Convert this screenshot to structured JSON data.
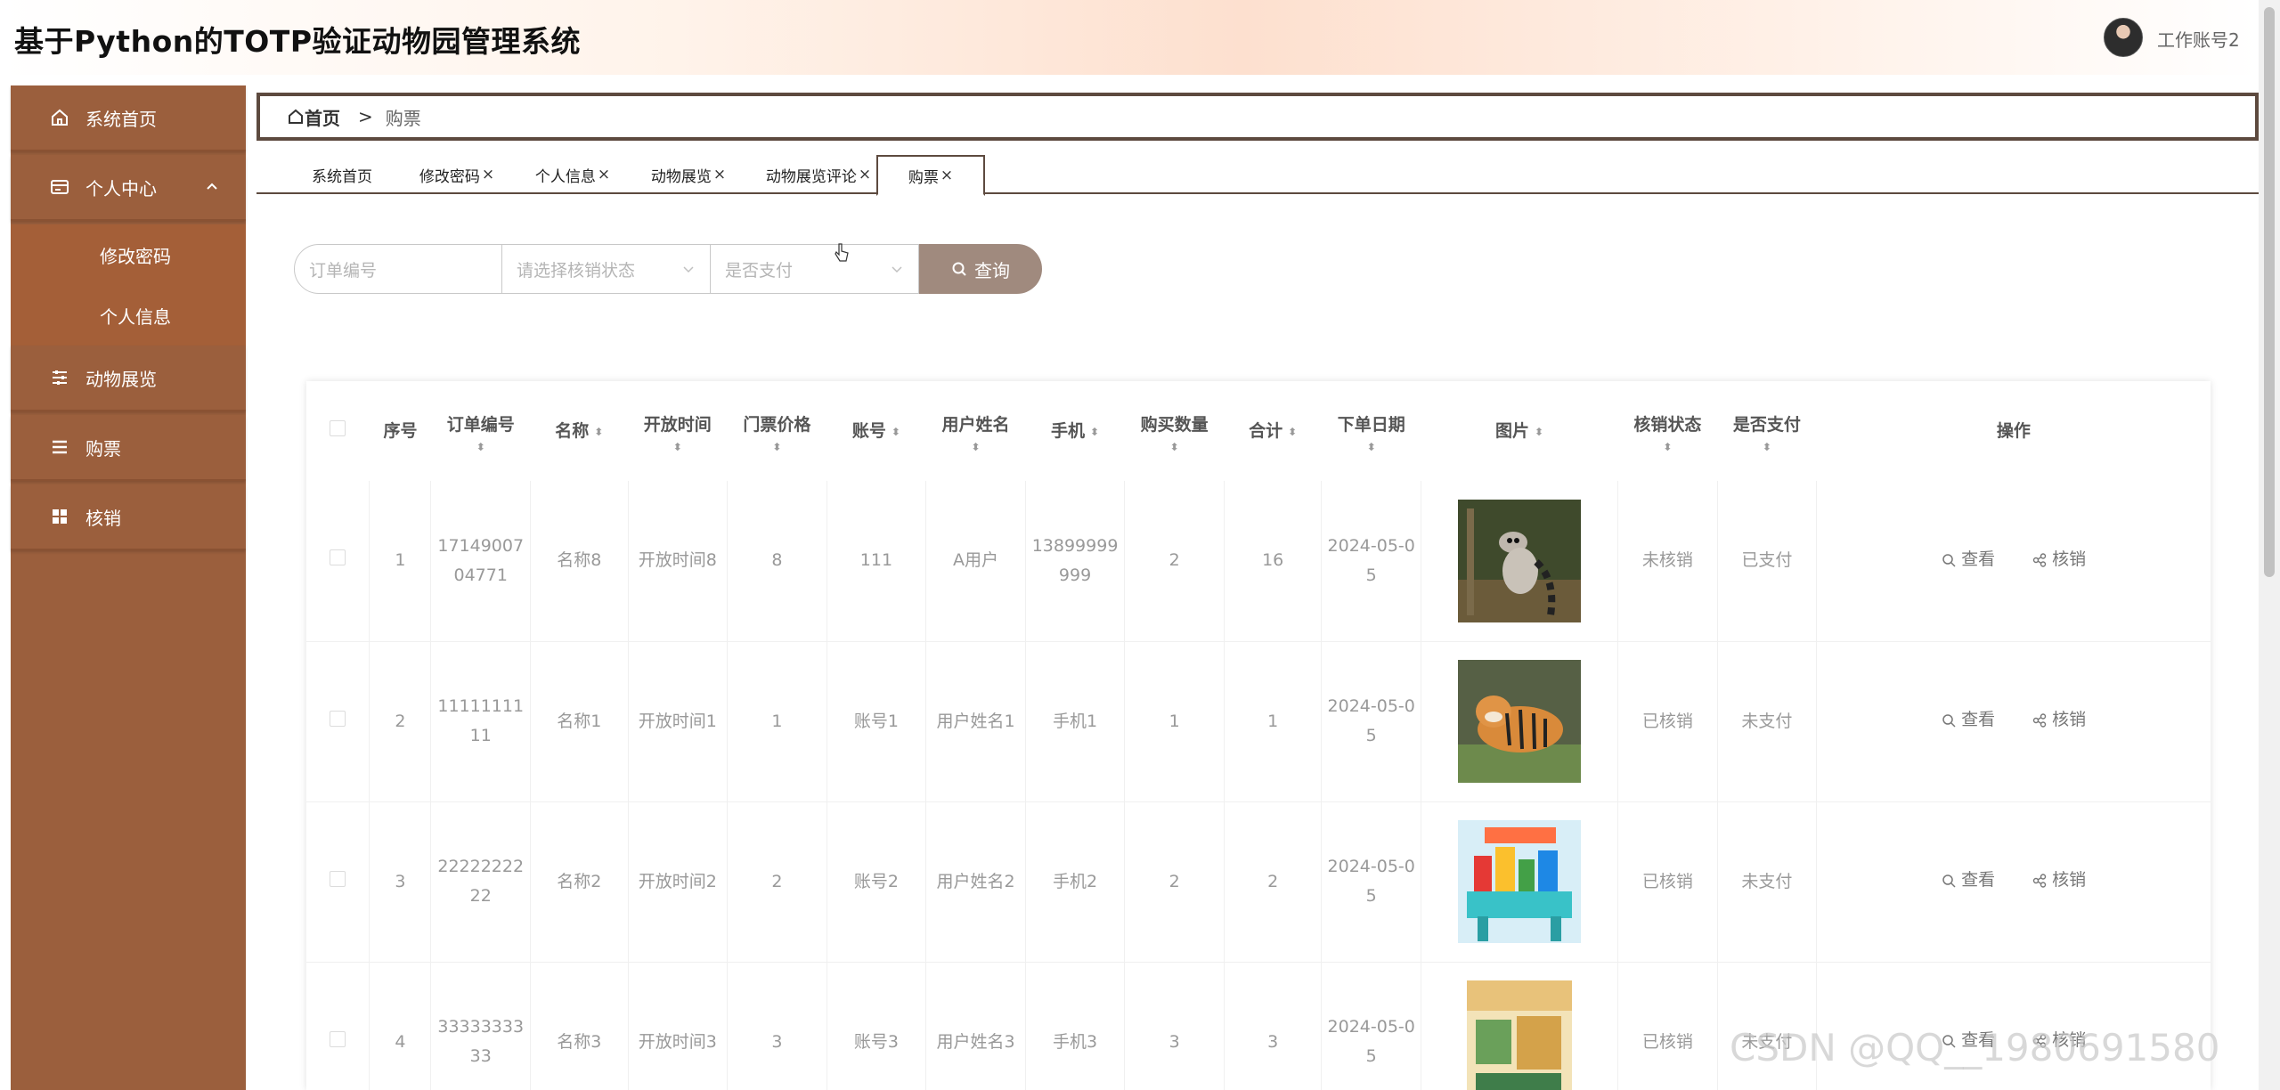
{
  "header": {
    "title": "基于Python的TOTP验证动物园管理系统",
    "user": "工作账号2"
  },
  "sidebar": {
    "items": [
      {
        "label": "系统首页",
        "icon": "home-icon"
      },
      {
        "label": "个人中心",
        "icon": "profile-card-icon"
      },
      {
        "label": "动物展览",
        "icon": "sliders-icon"
      },
      {
        "label": "购票",
        "icon": "list-icon"
      },
      {
        "label": "核销",
        "icon": "grid-icon"
      }
    ],
    "submenu": [
      {
        "label": "修改密码"
      },
      {
        "label": "个人信息"
      }
    ]
  },
  "breadcrumb": {
    "home": "首页",
    "separator": ">",
    "current": "购票"
  },
  "tabs": [
    {
      "label": "系统首页",
      "closable": false
    },
    {
      "label": "修改密码",
      "closable": true
    },
    {
      "label": "个人信息",
      "closable": true
    },
    {
      "label": "动物展览",
      "closable": true
    },
    {
      "label": "动物展览评论",
      "closable": true
    },
    {
      "label": "购票",
      "closable": true,
      "active": true
    }
  ],
  "search": {
    "order_placeholder": "订单编号",
    "status_placeholder": "请选择核销状态",
    "paid_placeholder": "是否支付",
    "button": "查询"
  },
  "table": {
    "headers": [
      "序号",
      "订单编号",
      "名称",
      "开放时间",
      "门票价格",
      "账号",
      "用户姓名",
      "手机",
      "购买数量",
      "合计",
      "下单日期",
      "图片",
      "核销状态",
      "是否支付",
      "操作"
    ],
    "rows": [
      {
        "idx": "1",
        "order": "1714900704771",
        "name": "名称8",
        "open": "开放时间8",
        "price": "8",
        "account": "111",
        "user": "A用户",
        "phone": "13899999999",
        "qty": "2",
        "total": "16",
        "date": "2024-05-05",
        "image": "lemur-photo",
        "status": "未核销",
        "paid": "已支付"
      },
      {
        "idx": "2",
        "order": "1111111111",
        "name": "名称1",
        "open": "开放时间1",
        "price": "1",
        "account": "账号1",
        "user": "用户姓名1",
        "phone": "手机1",
        "qty": "1",
        "total": "1",
        "date": "2024-05-05",
        "image": "tiger-photo",
        "status": "已核销",
        "paid": "未支付"
      },
      {
        "idx": "3",
        "order": "2222222222",
        "name": "名称2",
        "open": "开放时间2",
        "price": "2",
        "account": "账号2",
        "user": "用户姓名2",
        "phone": "手机2",
        "qty": "2",
        "total": "2",
        "date": "2024-05-05",
        "image": "toy-blocks-photo",
        "status": "已核销",
        "paid": "未支付"
      },
      {
        "idx": "4",
        "order": "3333333333",
        "name": "名称3",
        "open": "开放时间3",
        "price": "3",
        "account": "账号3",
        "user": "用户姓名3",
        "phone": "手机3",
        "qty": "3",
        "total": "3",
        "date": "2024-05-05",
        "image": "book-cover-photo",
        "status": "已核销",
        "paid": "未支付"
      }
    ],
    "actions": {
      "view": "查看",
      "verify": "核销"
    }
  },
  "watermark": "CSDN @QQ__1980691580",
  "colors": {
    "sidebar": "#9b5f3d",
    "submenu": "#a45f38",
    "accent": "#5d4a3f",
    "button": "#a08a7e"
  }
}
